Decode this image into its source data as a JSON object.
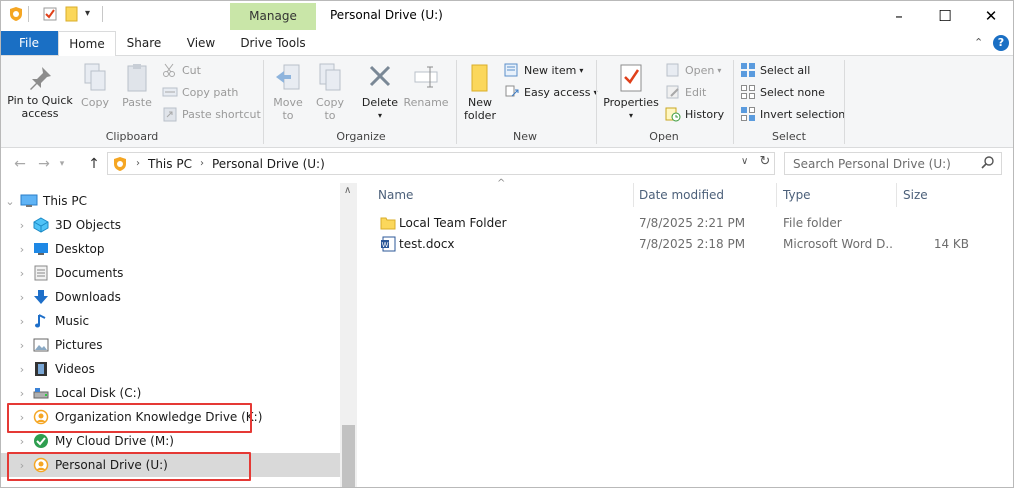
{
  "window": {
    "title": "Personal Drive (U:)",
    "context_tab": "Manage",
    "controls": {
      "minimize": "–",
      "maximize": "☐",
      "close": "✕"
    }
  },
  "ribbon": {
    "tabs": [
      "File",
      "Home",
      "Share",
      "View",
      "Drive Tools"
    ],
    "active_tab": "Home",
    "clipboard": {
      "label": "Clipboard",
      "pin": "Pin to Quick access",
      "pin_line1": "Pin to Quick",
      "pin_line2": "access",
      "copy": "Copy",
      "paste": "Paste",
      "cut": "Cut",
      "copy_path": "Copy path",
      "paste_shortcut": "Paste shortcut"
    },
    "organize": {
      "label": "Organize",
      "move_to_1": "Move",
      "move_to_2": "to",
      "copy_to_1": "Copy",
      "copy_to_2": "to",
      "delete": "Delete",
      "rename": "Rename"
    },
    "new": {
      "label": "New",
      "new_folder_1": "New",
      "new_folder_2": "folder",
      "new_item": "New item",
      "easy_access": "Easy access"
    },
    "open": {
      "label": "Open",
      "properties": "Properties",
      "open": "Open",
      "edit": "Edit",
      "history": "History"
    },
    "select": {
      "label": "Select",
      "select_all": "Select all",
      "select_none": "Select none",
      "invert_selection": "Invert selection"
    },
    "colors": {
      "file_tab": "#1a6fc4",
      "manage_tab": "#c9e6a8"
    }
  },
  "address": {
    "crumbs": [
      "This PC",
      "Personal Drive (U:)"
    ],
    "search_placeholder": "Search Personal Drive (U:)"
  },
  "nav_pane": {
    "root": "This PC",
    "items": [
      {
        "label": "3D Objects",
        "icon": "3d-objects-icon"
      },
      {
        "label": "Desktop",
        "icon": "desktop-icon"
      },
      {
        "label": "Documents",
        "icon": "documents-icon"
      },
      {
        "label": "Downloads",
        "icon": "downloads-icon"
      },
      {
        "label": "Music",
        "icon": "music-icon"
      },
      {
        "label": "Pictures",
        "icon": "pictures-icon"
      },
      {
        "label": "Videos",
        "icon": "videos-icon"
      },
      {
        "label": "Local Disk (C:)",
        "icon": "local-disk-icon"
      },
      {
        "label": "Organization Knowledge Drive (K:)",
        "icon": "network-drive-icon"
      },
      {
        "label": "My Cloud Drive (M:)",
        "icon": "cloud-drive-icon"
      },
      {
        "label": "Personal Drive (U:)",
        "icon": "network-drive-icon"
      }
    ],
    "selected": "Personal Drive (U:)",
    "highlight_color": "#e53935"
  },
  "content": {
    "columns": [
      "Name",
      "Date modified",
      "Type",
      "Size"
    ],
    "rows": [
      {
        "name": "Local Team Folder",
        "date": "7/8/2025 2:21 PM",
        "type": "File folder",
        "size": "",
        "icon": "folder-icon"
      },
      {
        "name": "test.docx",
        "date": "7/8/2025 2:18 PM",
        "type": "Microsoft Word D...",
        "size": "14 KB",
        "icon": "word-document-icon"
      }
    ]
  }
}
